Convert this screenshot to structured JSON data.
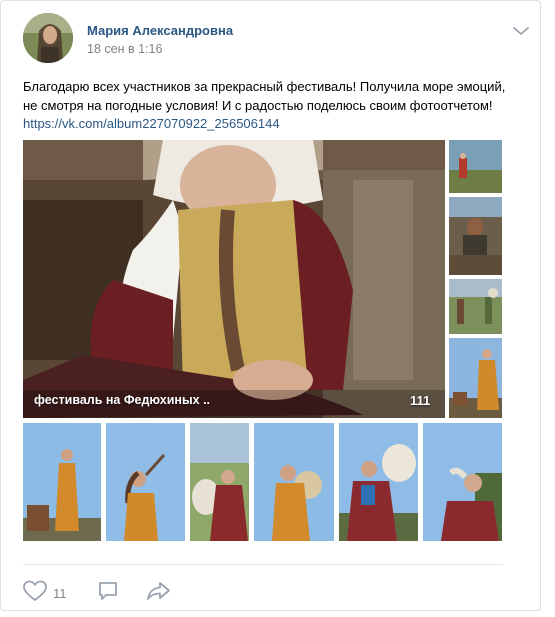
{
  "post": {
    "author": "Мария Александровна",
    "date": "18 сен в 1:16",
    "text": "Благодарю всех участников за прекрасный фестиваль! Получила море эмоций, не смотря на погодные условия! И с радостью поделюсь своим фотоотчетом!",
    "link": "https://vk.com/album227070922_256506144"
  },
  "album": {
    "caption": "фестиваль на Федюхиных ..",
    "count": "111"
  },
  "actions": {
    "like_count": "11"
  },
  "colors": {
    "link": "#2a5885",
    "meta": "#828282",
    "border": "#dce1e6",
    "icon": "#99a2ad"
  },
  "icons": [
    "chevron-down-icon",
    "heart-icon",
    "comment-icon",
    "share-icon"
  ]
}
